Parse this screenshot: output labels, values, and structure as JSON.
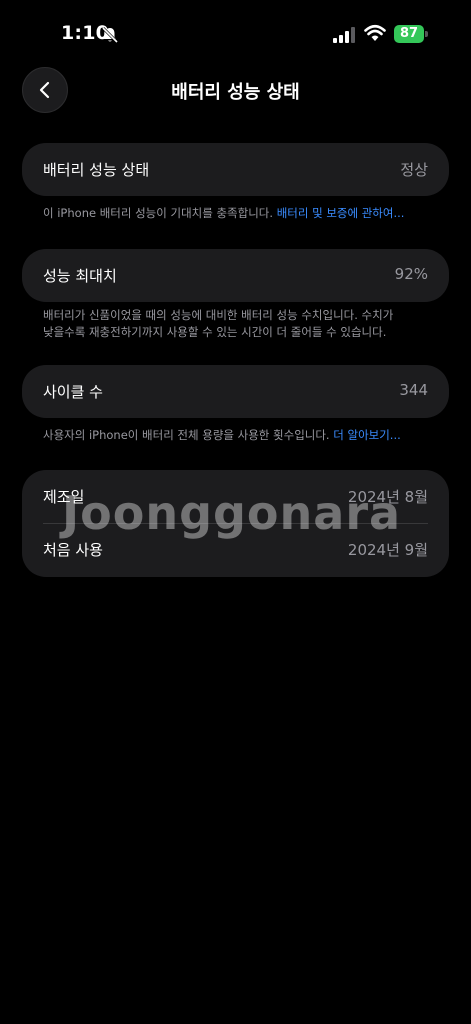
{
  "status": {
    "time": "1:10",
    "battery": "87"
  },
  "header": {
    "title": "배터리 성능 상태"
  },
  "health": {
    "label": "배터리 성능 상태",
    "value": "정상",
    "caption": "이 iPhone 배터리 성능이 기대치를 충족합니다.",
    "caption_link": "배터리 및 보증에 관하여..."
  },
  "max_capacity": {
    "label": "성능 최대치",
    "value": "92%",
    "caption_line1": "배터리가 신품이었을 때의 성능에 대비한 배터리 성능 수치입니다. 수치가",
    "caption_line2": "낮을수록 재충전하기까지 사용할 수 있는 시간이 더 줄어들 수 있습니다."
  },
  "cycle_count": {
    "label": "사이클 수",
    "value": "344",
    "caption": "사용자의 iPhone이 배터리 전체 용량을 사용한 횟수입니다.",
    "caption_link": "더 알아보기..."
  },
  "dates": {
    "manufacture_label": "제조일",
    "manufacture_value": "2024년 8월",
    "first_use_label": "처음 사용",
    "first_use_value": "2024년 9월"
  },
  "watermark": "Joonggonara"
}
